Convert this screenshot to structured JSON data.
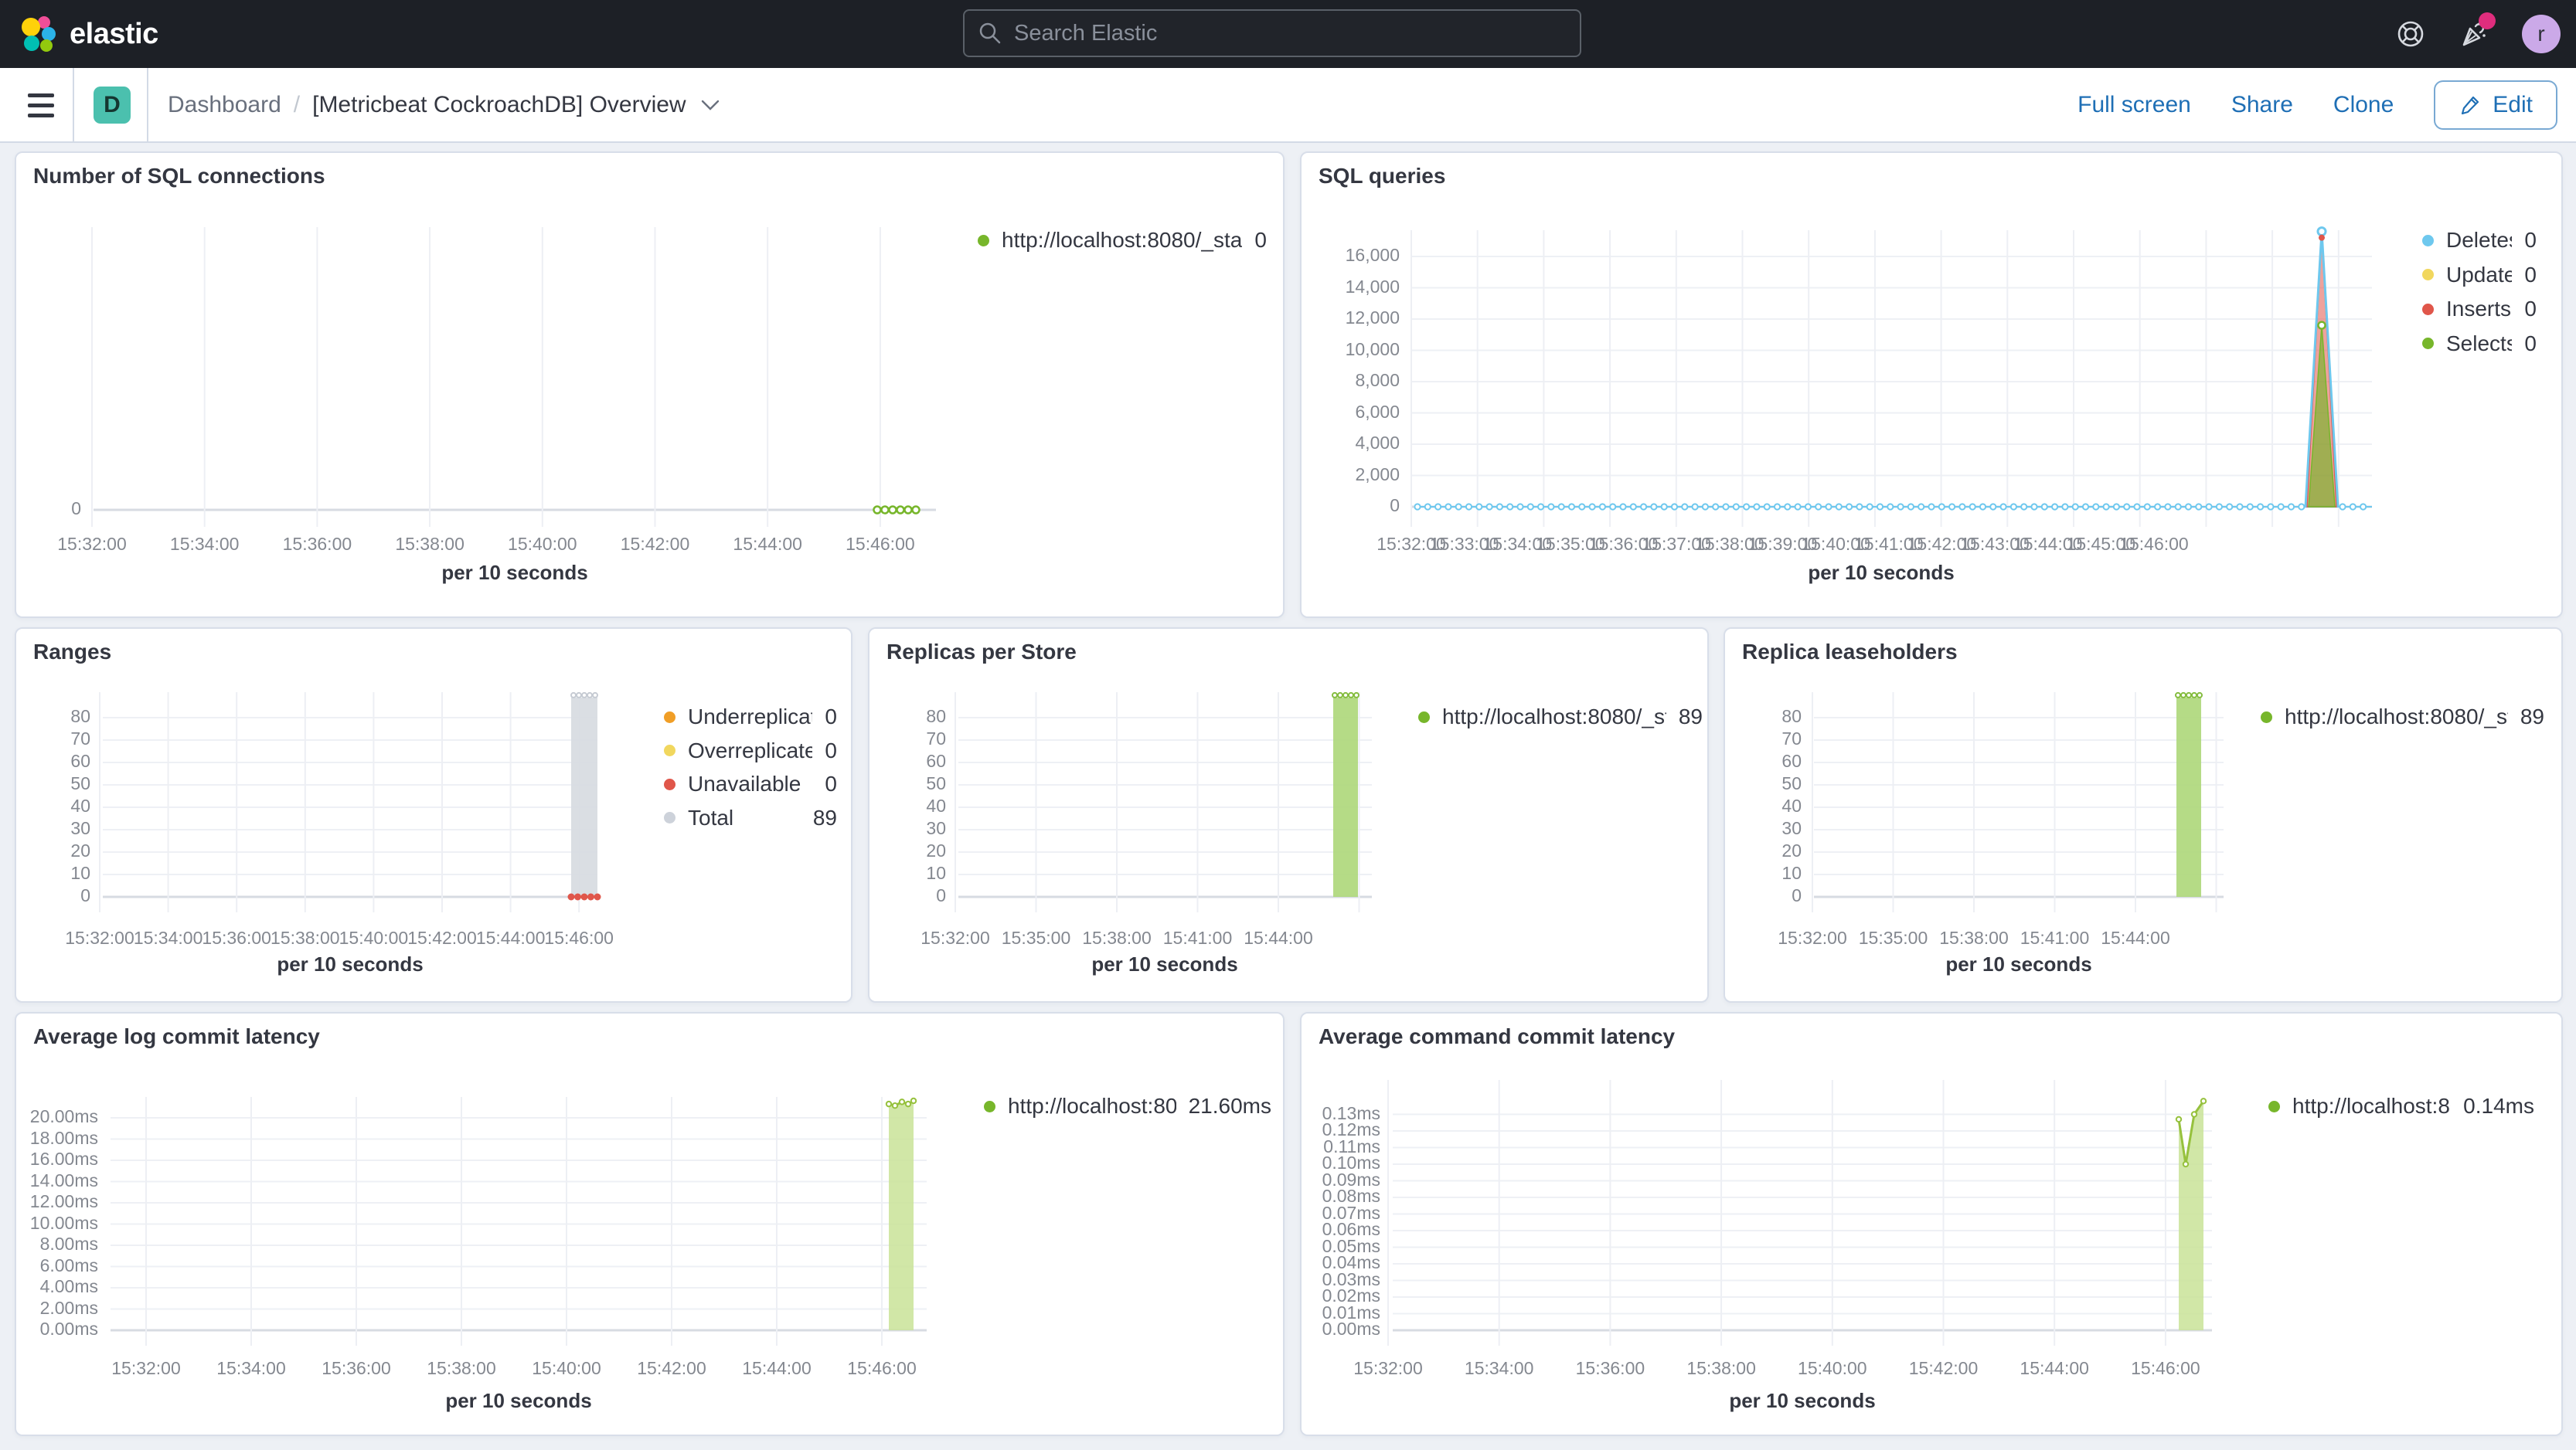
{
  "navbar": {
    "logo_text": "elastic",
    "search_placeholder": "Search Elastic",
    "avatar_initial": "r",
    "avatar_color": "#cba9e8",
    "notification_dot_color": "#df2d7d",
    "background": "#1d2026"
  },
  "toolbar": {
    "badge_letter": "D",
    "badge_color": "#4bc0ae",
    "breadcrumb_root": "Dashboard",
    "breadcrumb_separator": "/",
    "title": "[Metricbeat CockroachDB] Overview",
    "actions": {
      "full_screen": "Full screen",
      "share": "Share",
      "clone": "Clone",
      "edit": "Edit"
    },
    "link_color": "#1f6fb5"
  },
  "panels": [
    {
      "id": "sql_connections",
      "title": "Number of SQL connections",
      "x_axis_title": "per 10 seconds",
      "legend": [
        {
          "label": "http://localhost:8080/_stat...",
          "value": "0",
          "color": "#77b62b"
        }
      ],
      "chart_data": {
        "type": "line",
        "x_ticks": [
          "15:32:00",
          "15:34:00",
          "15:36:00",
          "15:38:00",
          "15:40:00",
          "15:42:00",
          "15:44:00",
          "15:46:00"
        ],
        "y_ticks": [
          "0"
        ],
        "y_step": 0,
        "series": [
          {
            "name": "http://localhost:8080/_stat...",
            "color": "#77b62b",
            "values": [
              0,
              0,
              0,
              0,
              0,
              0
            ],
            "note": "flat zero segment near 15:46"
          }
        ]
      }
    },
    {
      "id": "sql_queries",
      "title": "SQL queries",
      "x_axis_title": "per 10 seconds",
      "legend": [
        {
          "label": "Deletes",
          "value": "0",
          "color": "#6ec8ee"
        },
        {
          "label": "Updates",
          "value": "0",
          "color": "#f1d75e"
        },
        {
          "label": "Inserts",
          "value": "0",
          "color": "#e0564a"
        },
        {
          "label": "Selects",
          "value": "0",
          "color": "#77b62b"
        }
      ],
      "chart_data": {
        "type": "line",
        "x_ticks": [
          "15:32:00",
          "15:33:00",
          "15:34:00",
          "15:35:00",
          "15:36:00",
          "15:37:00",
          "15:38:00",
          "15:39:00",
          "15:40:00",
          "15:41:00",
          "15:42:00",
          "15:43:00",
          "15:44:00",
          "15:45:00",
          "15:46:00"
        ],
        "y_ticks": [
          "0",
          "2,000",
          "4,000",
          "6,000",
          "8,000",
          "10,000",
          "12,000",
          "14,000",
          "16,000"
        ],
        "y_step": 2000,
        "ylim": [
          0,
          17600
        ],
        "spike_time": "15:46:00",
        "series": [
          {
            "name": "Deletes",
            "color": "#6ec8ee",
            "baseline": 0,
            "spike_value": 17600
          },
          {
            "name": "Updates",
            "color": "#f1d75e",
            "baseline": 0,
            "spike_value": 0
          },
          {
            "name": "Inserts",
            "color": "#e0564a",
            "baseline": 0,
            "spike_value": 17400
          },
          {
            "name": "Selects",
            "color": "#77b62b",
            "baseline": 0,
            "spike_value": 11600
          }
        ]
      }
    },
    {
      "id": "ranges",
      "title": "Ranges",
      "x_axis_title": "per 10 seconds",
      "legend": [
        {
          "label": "Underreplicated",
          "value": "0",
          "color": "#f09e26"
        },
        {
          "label": "Overreplicated",
          "value": "0",
          "color": "#f1d75e"
        },
        {
          "label": "Unavailable",
          "value": "0",
          "color": "#e0564a"
        },
        {
          "label": "Total",
          "value": "89",
          "color": "#cdd2da"
        }
      ],
      "chart_data": {
        "type": "bar",
        "x_ticks": [
          "15:32:00",
          "15:34:00",
          "15:36:00",
          "15:38:00",
          "15:40:00",
          "15:42:00",
          "15:44:00",
          "15:46:00"
        ],
        "y_ticks": [
          "0",
          "10",
          "20",
          "30",
          "40",
          "50",
          "60",
          "70",
          "80"
        ],
        "y_step": 10,
        "bar_time": "15:46:00",
        "series": [
          {
            "name": "Underreplicated",
            "color": "#f09e26",
            "value": 0
          },
          {
            "name": "Overreplicated",
            "color": "#f1d75e",
            "value": 0
          },
          {
            "name": "Unavailable",
            "color": "#e0564a",
            "value": 0
          },
          {
            "name": "Total",
            "color": "#d7dbe1",
            "value": 89
          }
        ]
      }
    },
    {
      "id": "replicas_per_store",
      "title": "Replicas per Store",
      "x_axis_title": "per 10 seconds",
      "legend": [
        {
          "label": "http://localhost:8080/_sta...",
          "value": "89",
          "color": "#77b62b"
        }
      ],
      "chart_data": {
        "type": "bar",
        "x_ticks": [
          "15:32:00",
          "15:35:00",
          "15:38:00",
          "15:41:00",
          "15:44:00"
        ],
        "y_ticks": [
          "0",
          "10",
          "20",
          "30",
          "40",
          "50",
          "60",
          "70",
          "80"
        ],
        "y_step": 10,
        "bar_time": "15:46:00",
        "series": [
          {
            "name": "http://localhost:8080/_sta...",
            "color": "#afd87c",
            "value": 89
          }
        ]
      }
    },
    {
      "id": "replica_leaseholders",
      "title": "Replica leaseholders",
      "x_axis_title": "per 10 seconds",
      "legend": [
        {
          "label": "http://localhost:8080/_sta...",
          "value": "89",
          "color": "#77b62b"
        }
      ],
      "chart_data": {
        "type": "bar",
        "x_ticks": [
          "15:32:00",
          "15:35:00",
          "15:38:00",
          "15:41:00",
          "15:44:00"
        ],
        "y_ticks": [
          "0",
          "10",
          "20",
          "30",
          "40",
          "50",
          "60",
          "70",
          "80"
        ],
        "y_step": 10,
        "bar_time": "15:46:00",
        "series": [
          {
            "name": "http://localhost:8080/_sta...",
            "color": "#afd87c",
            "value": 89
          }
        ]
      }
    },
    {
      "id": "avg_log_commit_latency",
      "title": "Average log commit latency",
      "x_axis_title": "per 10 seconds",
      "legend": [
        {
          "label": "http://localhost:808...",
          "value": "21.60ms",
          "color": "#77b62b"
        }
      ],
      "chart_data": {
        "type": "area",
        "x_ticks": [
          "15:32:00",
          "15:34:00",
          "15:36:00",
          "15:38:00",
          "15:40:00",
          "15:42:00",
          "15:44:00",
          "15:46:00"
        ],
        "y_ticks": [
          "0.00ms",
          "2.00ms",
          "4.00ms",
          "6.00ms",
          "8.00ms",
          "10.00ms",
          "12.00ms",
          "14.00ms",
          "16.00ms",
          "18.00ms",
          "20.00ms"
        ],
        "y_step": 2,
        "series": [
          {
            "name": "http://localhost:808...",
            "line_color": "#96c13d",
            "fill_color": "#c9e398",
            "points_ms": [
              21.3,
              21.15,
              21.5,
              21.3,
              21.6
            ],
            "current": "21.60ms"
          }
        ]
      }
    },
    {
      "id": "avg_command_commit_latency",
      "title": "Average command commit latency",
      "x_axis_title": "per 10 seconds",
      "legend": [
        {
          "label": "http://localhost:8080...",
          "value": "0.14ms",
          "color": "#77b62b"
        }
      ],
      "chart_data": {
        "type": "area",
        "x_ticks": [
          "15:32:00",
          "15:34:00",
          "15:36:00",
          "15:38:00",
          "15:40:00",
          "15:42:00",
          "15:44:00",
          "15:46:00"
        ],
        "y_ticks": [
          "0.00ms",
          "0.01ms",
          "0.02ms",
          "0.03ms",
          "0.04ms",
          "0.05ms",
          "0.06ms",
          "0.07ms",
          "0.08ms",
          "0.09ms",
          "0.10ms",
          "0.11ms",
          "0.12ms",
          "0.13ms"
        ],
        "y_step": 0.01,
        "series": [
          {
            "name": "http://localhost:8080...",
            "line_color": "#96c13d",
            "fill_color": "#c9e398",
            "points_ms": [
              0.127,
              0.1,
              0.13,
              0.138
            ],
            "current": "0.14ms"
          }
        ]
      }
    }
  ]
}
